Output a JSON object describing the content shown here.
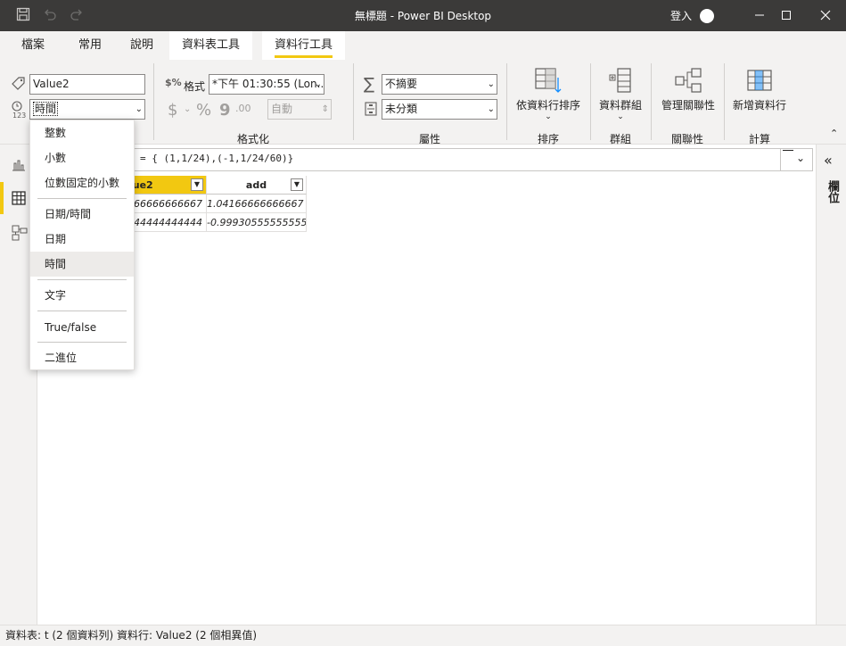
{
  "window": {
    "title": "無標題 - Power BI Desktop",
    "signin": "登入"
  },
  "tabs": [
    {
      "label": "檔案"
    },
    {
      "label": "常用"
    },
    {
      "label": "說明"
    },
    {
      "label": "資料表工具"
    },
    {
      "label": "資料行工具"
    }
  ],
  "ribbon": {
    "column_name": "Value2",
    "data_type": "時間",
    "format_label": "格式",
    "format_value": "*下午 01:30:55 (Lon...",
    "currency_symbol": "$",
    "percent_symbol": "%",
    "comma_symbol": "9",
    "decimal_symbol": ".00",
    "auto_value": "自動",
    "summarization": "不摘要",
    "category": "未分類",
    "format_group": "格式化",
    "properties_group": "屬性",
    "sort_by_column": "依資料行排序",
    "sort_group": "排序",
    "data_groups": "資料群組",
    "groups_group": "群組",
    "manage_relationships": "管理關聯性",
    "relationships_group": "關聯性",
    "new_column": "新增資料行",
    "calculations_group": "計算"
  },
  "formula": {
    "text": "= { (1,1/24),(-1,1/24/60)}"
  },
  "table": {
    "columns": [
      {
        "name": "Value2",
        "visible": "lue2"
      },
      {
        "name": "add",
        "visible": "add"
      }
    ],
    "rows": [
      [
        "666666666667",
        "1.04166666666667"
      ],
      [
        "444444444444",
        "-0.999305555555556"
      ]
    ]
  },
  "right_pane": {
    "label": "欄位"
  },
  "status": {
    "text": "資料表: t (2 個資料列) 資料行: Value2 (2 個相異值)"
  },
  "dropdown": {
    "items": [
      "整數",
      "小數",
      "位數固定的小數",
      "日期/時間",
      "日期",
      "時間",
      "文字",
      "True/false",
      "二進位"
    ],
    "selected": "時間"
  },
  "colors": {
    "accent": "#f2c811",
    "titlebar": "#3b3a39",
    "ribbon": "#f3f2f1"
  }
}
